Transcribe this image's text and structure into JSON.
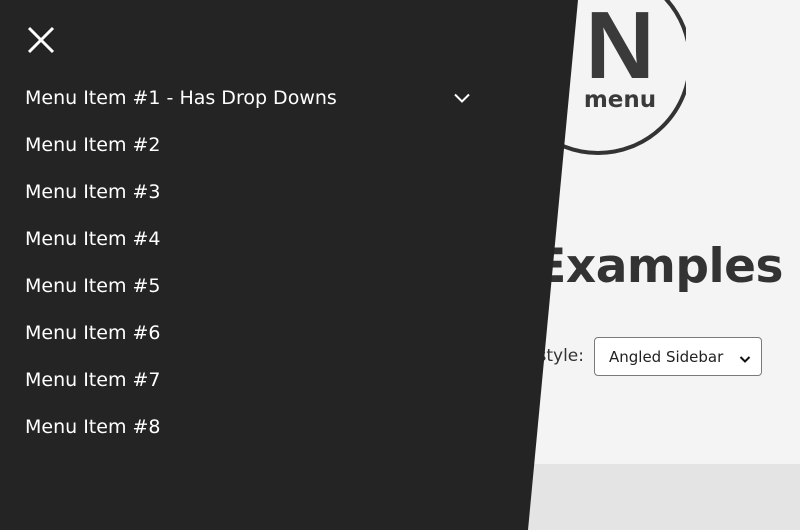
{
  "logo": {
    "letter": "N",
    "word": "menu"
  },
  "page": {
    "heading": "Examples",
    "style_label": "style:",
    "style_select_value": "Angled Sidebar"
  },
  "colors": {
    "sidebar_bg": "#242424",
    "page_bg": "#f4f4f4",
    "page_bottom_bg": "#e4e4e4",
    "text_dark": "#333333",
    "menu_text": "#ffffff"
  },
  "sidebar": {
    "close_icon": "close-icon",
    "items": [
      {
        "label": "Menu Item #1 - Has Drop Downs",
        "has_dropdown": true,
        "icon": "chevron-down-icon"
      },
      {
        "label": "Menu Item #2"
      },
      {
        "label": "Menu Item #3"
      },
      {
        "label": "Menu Item #4"
      },
      {
        "label": "Menu Item #5"
      },
      {
        "label": "Menu Item #6"
      },
      {
        "label": "Menu Item #7"
      },
      {
        "label": "Menu Item #8"
      }
    ]
  }
}
